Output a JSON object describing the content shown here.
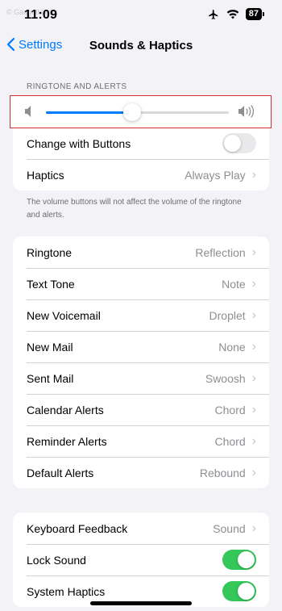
{
  "status_bar": {
    "time": "11:09",
    "watermark": "© GadgetHacks",
    "battery": "87"
  },
  "nav": {
    "back_label": "Settings",
    "title": "Sounds & Haptics"
  },
  "ringtone_section": {
    "header": "RINGTONE AND ALERTS",
    "volume_level": 0.47,
    "change_with_buttons": {
      "label": "Change with Buttons",
      "enabled": false
    },
    "haptics": {
      "label": "Haptics",
      "value": "Always Play"
    },
    "footnote": "The volume buttons will not affect the volume of the ringtone and alerts."
  },
  "tones": [
    {
      "label": "Ringtone",
      "value": "Reflection"
    },
    {
      "label": "Text Tone",
      "value": "Note"
    },
    {
      "label": "New Voicemail",
      "value": "Droplet"
    },
    {
      "label": "New Mail",
      "value": "None"
    },
    {
      "label": "Sent Mail",
      "value": "Swoosh"
    },
    {
      "label": "Calendar Alerts",
      "value": "Chord"
    },
    {
      "label": "Reminder Alerts",
      "value": "Chord"
    },
    {
      "label": "Default Alerts",
      "value": "Rebound"
    }
  ],
  "feedback": {
    "keyboard": {
      "label": "Keyboard Feedback",
      "value": "Sound"
    },
    "lock_sound": {
      "label": "Lock Sound",
      "enabled": true
    },
    "system_haptics": {
      "label": "System Haptics",
      "enabled": true
    }
  },
  "colors": {
    "accent": "#007aff",
    "toggle_on": "#34c759",
    "highlight_border": "#d23030"
  }
}
